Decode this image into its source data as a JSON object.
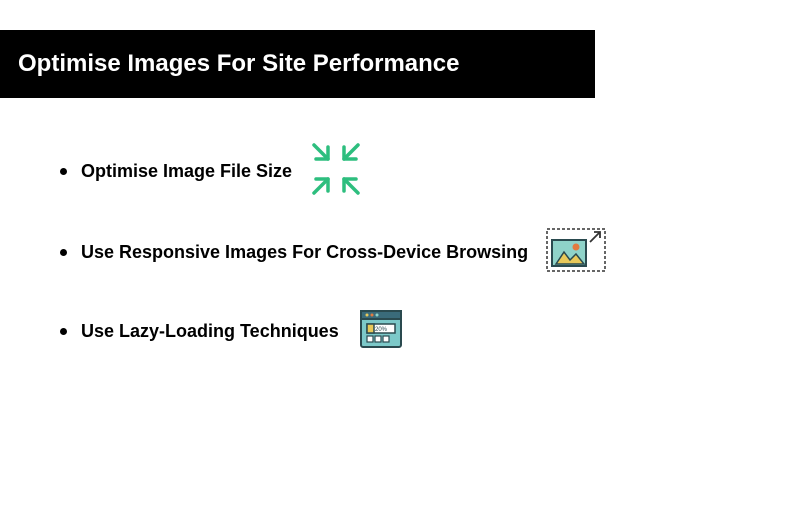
{
  "header": {
    "title": "Optimise Images For Site Performance"
  },
  "bullets": {
    "items": [
      {
        "label": "Optimise Image File Size"
      },
      {
        "label": "Use Responsive Images For Cross-Device Browsing"
      },
      {
        "label": "Use Lazy-Loading Techniques"
      }
    ]
  }
}
